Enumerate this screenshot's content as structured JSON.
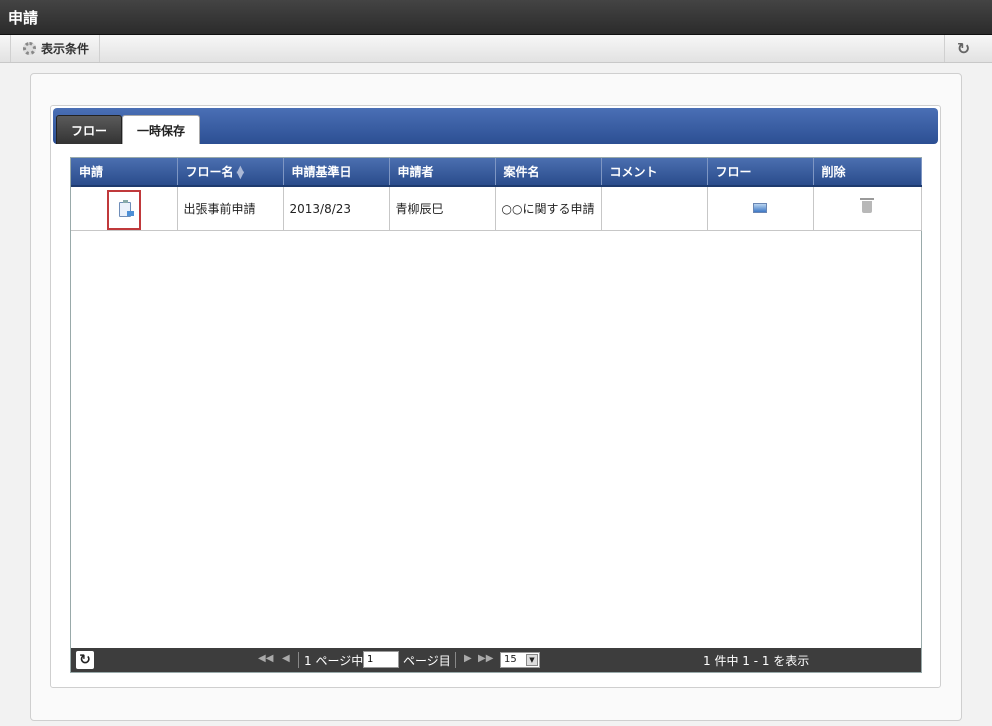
{
  "window": {
    "title": "申請"
  },
  "toolbar": {
    "display_conditions_label": "表示条件",
    "refresh_icon": "refresh-icon"
  },
  "tabs": [
    {
      "label": "フロー",
      "active": false
    },
    {
      "label": "一時保存",
      "active": true
    }
  ],
  "table": {
    "headers": [
      "申請",
      "フロー名",
      "申請基準日",
      "申請者",
      "案件名",
      "コメント",
      "フロー",
      "削除"
    ],
    "rows": [
      {
        "apply_icon": "document-icon",
        "flow_name": "出張事前申請",
        "base_date": "2013/8/23",
        "applicant": "青柳辰巳",
        "matter_name": "○○に関する申請",
        "comment": "",
        "flow_icon": "image-icon",
        "delete_icon": "trash-icon"
      }
    ]
  },
  "pager": {
    "page_prefix": "1 ページ中",
    "page_value": "1",
    "page_suffix": "ページ目",
    "page_size": "15",
    "count_text": "1 件中 1 - 1 を表示"
  },
  "colors": {
    "header_blue": "#2c4f93",
    "highlight_red": "#c0393b",
    "pager_bg": "#3d3d3d"
  }
}
